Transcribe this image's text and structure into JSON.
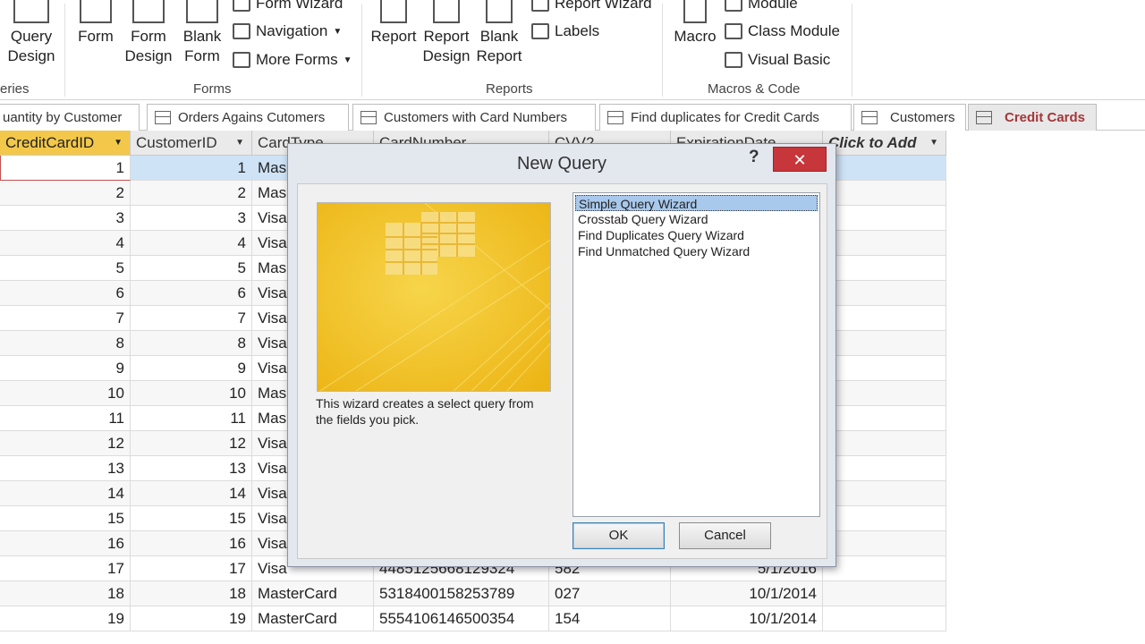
{
  "ribbon": {
    "query_design": [
      "Query",
      "Design"
    ],
    "queries_label": "eries",
    "form": "Form",
    "form_design": [
      "Form",
      "Design"
    ],
    "blank_form": [
      "Blank",
      "Form"
    ],
    "form_wizard": "Form Wizard",
    "navigation": "Navigation",
    "more_forms": "More Forms",
    "forms_label": "Forms",
    "report": "Report",
    "report_design": [
      "Report",
      "Design"
    ],
    "blank_report": [
      "Blank",
      "Report"
    ],
    "report_wizard": "Report Wizard",
    "labels": "Labels",
    "reports_label": "Reports",
    "macro": "Macro",
    "module": "Module",
    "class_module": "Class Module",
    "visual_basic": "Visual Basic",
    "macros_label": "Macros & Code"
  },
  "tabs": [
    {
      "label": "uantity by Customer"
    },
    {
      "label": "Orders Agains Cutomers"
    },
    {
      "label": "Customers with Card Numbers"
    },
    {
      "label": "Find duplicates for Credit Cards"
    },
    {
      "label": "Customers"
    },
    {
      "label": "Credit Cards",
      "active": true
    }
  ],
  "table": {
    "columns": [
      "CreditCardID",
      "CustomerID",
      "CardType",
      "CardNumber",
      "CVV2",
      "ExpirationDate",
      "Click to Add"
    ],
    "rows": [
      [
        "1",
        "1",
        "Mas",
        "",
        "",
        ""
      ],
      [
        "2",
        "2",
        "Mas",
        "",
        "",
        ""
      ],
      [
        "3",
        "3",
        "Visa",
        "",
        "",
        ""
      ],
      [
        "4",
        "4",
        "Visa",
        "",
        "",
        ""
      ],
      [
        "5",
        "5",
        "Mas",
        "",
        "",
        ""
      ],
      [
        "6",
        "6",
        "Visa",
        "",
        "",
        ""
      ],
      [
        "7",
        "7",
        "Visa",
        "",
        "",
        ""
      ],
      [
        "8",
        "8",
        "Visa",
        "",
        "",
        ""
      ],
      [
        "9",
        "9",
        "Visa",
        "",
        "",
        ""
      ],
      [
        "10",
        "10",
        "Mas",
        "",
        "",
        ""
      ],
      [
        "11",
        "11",
        "Mas",
        "",
        "",
        ""
      ],
      [
        "12",
        "12",
        "Visa",
        "",
        "",
        ""
      ],
      [
        "13",
        "13",
        "Visa",
        "",
        "",
        ""
      ],
      [
        "14",
        "14",
        "Visa",
        "",
        "",
        ""
      ],
      [
        "15",
        "15",
        "Visa",
        "",
        "",
        ""
      ],
      [
        "16",
        "16",
        "Visa",
        "",
        "",
        ""
      ],
      [
        "17",
        "17",
        "Visa",
        "4485125668129324",
        "582",
        "5/1/2016"
      ],
      [
        "18",
        "18",
        "MasterCard",
        "5318400158253789",
        "027",
        "10/1/2014"
      ],
      [
        "19",
        "19",
        "MasterCard",
        "5554106146500354",
        "154",
        "10/1/2014"
      ]
    ]
  },
  "dialog": {
    "title": "New Query",
    "help": "?",
    "close": "✕",
    "description": "This wizard creates a select query from the fields you pick.",
    "options": [
      "Simple Query Wizard",
      "Crosstab Query Wizard",
      "Find Duplicates Query Wizard",
      "Find Unmatched Query Wizard"
    ],
    "ok": "OK",
    "cancel": "Cancel"
  }
}
